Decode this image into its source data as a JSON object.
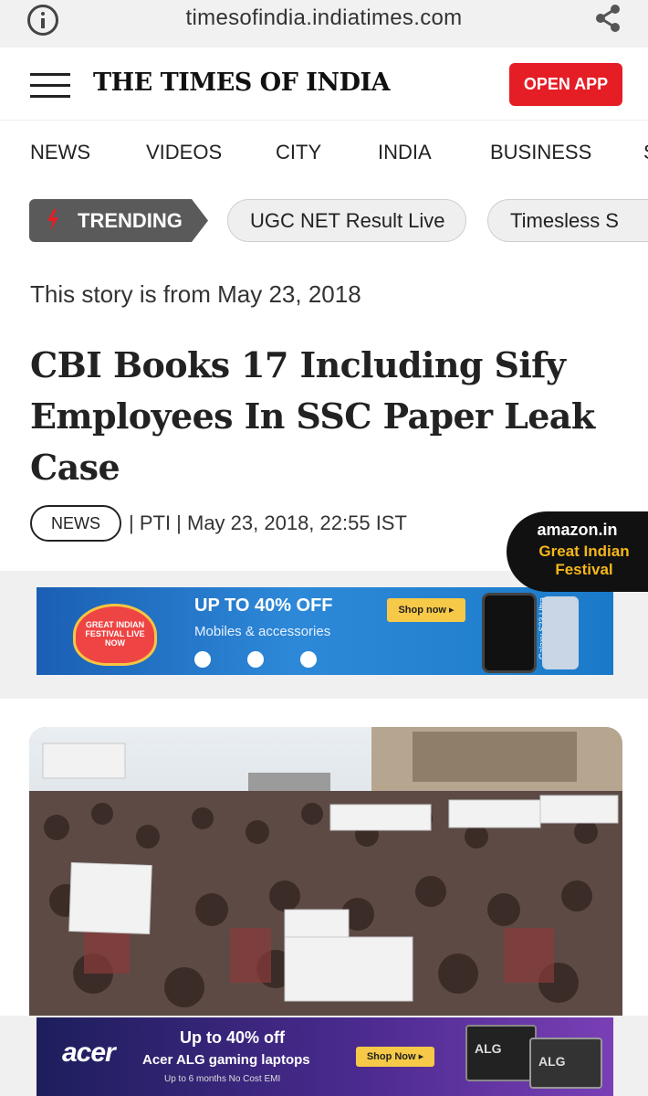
{
  "browser": {
    "url": "timesofindia.indiatimes.com",
    "info_icon": "info-icon",
    "share_icon": "share-icon"
  },
  "header": {
    "brand": "THE TIMES OF INDIA",
    "open_app": "OPEN APP",
    "menu_icon": "hamburger-menu-icon",
    "accent_color": "#e51d25"
  },
  "nav": {
    "items": [
      "NEWS",
      "VIDEOS",
      "CITY",
      "INDIA",
      "BUSINESS",
      "S"
    ]
  },
  "trending": {
    "label": "TRENDING",
    "icon": "lightning-bolt-icon",
    "chips": [
      "UGC NET Result Live",
      "Timesless S"
    ]
  },
  "article": {
    "story_date": "This story is from May 23, 2018",
    "headline": "CBI Books 17 Including Sify Employees In SSC Paper Leak Case",
    "category": "NEWS",
    "meta": "| PTI | May 23, 2018, 22:55 IST"
  },
  "amazon_badge": {
    "brand": "amazon.in",
    "title": "Great Indian Festival"
  },
  "ad_top": {
    "logo_text": "GREAT INDIAN FESTIVAL LIVE NOW",
    "offer": "UP TO 40% OFF",
    "subtitle": "Mobiles & accessories",
    "cta": "Shop now ▸",
    "phone_label": "Galaxy S23 Ultra"
  },
  "ad_bottom": {
    "brand": "acer",
    "offer": "Up to 40% off",
    "subtitle": "Acer ALG gaming laptops",
    "small": "Up to 6 months No Cost EMI",
    "cta": "Shop Now ▸",
    "product_label": "ALG"
  }
}
